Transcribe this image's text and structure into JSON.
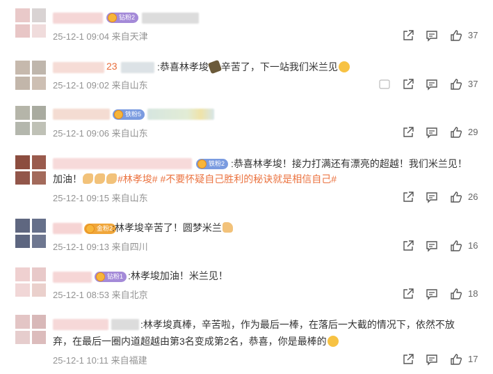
{
  "comments": [
    {
      "name_num": "",
      "badge": "钻粉2",
      "text": "",
      "time": "25-12-1 09:04 来自天津",
      "likes": "37"
    },
    {
      "name_num": "23",
      "badge": "",
      "text": ":恭喜林孝埈",
      "text2": "辛苦了，下一站我们米兰见",
      "time": "25-12-1 09:02 来自山东",
      "likes": "37"
    },
    {
      "name_num": "",
      "badge": "铁粉5",
      "text": "",
      "time": "25-12-1 09:06 来自山东",
      "likes": "29"
    },
    {
      "name_num": "",
      "badge": "铁粉2",
      "text": ":恭喜林孝埈！接力打满还有漂亮的超越！我们米兰见！",
      "line2_a": "加油！",
      "topic1": "#林孝埈#",
      "topic2": "#不要怀疑自己胜利的秘诀就是相信自己#",
      "time": "25-12-1 09:15 来自山东",
      "likes": "26"
    },
    {
      "name_num": "",
      "badge": "金粉2",
      "text": ":林孝埈辛苦了！圆梦米兰",
      "time": "25-12-1 09:13 来自四川",
      "likes": "16"
    },
    {
      "name_num": "",
      "badge": "钻粉1",
      "text": ":林孝埈加油！米兰见！",
      "time": "25-12-1 08:53 来自北京",
      "likes": "18"
    },
    {
      "name_num": "",
      "badge": "",
      "text": ":林孝埈真棒，辛苦啦，作为最后一棒，在落后一大截的情况下，依然不放",
      "line2": "弃，在最后一圈内道超越由第3名变成第2名，恭喜，你是最棒的",
      "time": "25-12-1 10:11 来自福建",
      "likes": "17"
    }
  ],
  "icons": [
    "share-icon",
    "comment-icon",
    "like-icon"
  ],
  "colors": {
    "topic": "#eb7340",
    "time": "#939393",
    "name_num": "#e86c3a",
    "badge_diamond": "#a48ad8",
    "badge_iron": "#7a9be0",
    "badge_gold": "#f0a63a"
  }
}
